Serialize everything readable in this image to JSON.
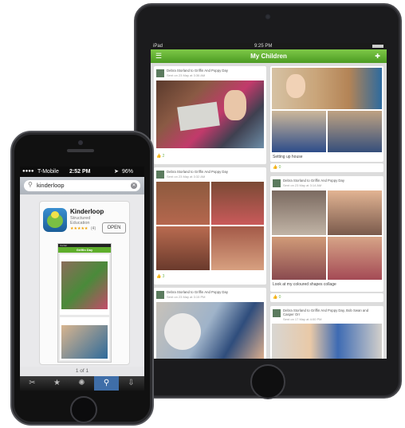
{
  "ipad": {
    "status": {
      "carrier": "iPad",
      "time": "9:25 PM"
    },
    "nav_title": "My Children",
    "cards": [
      {
        "who": "Debra Storland to Griffin And Poppy Day",
        "when": "Sent on 23 May at 3:36 AM",
        "caption": "",
        "likes": "2"
      },
      {
        "who": "",
        "when": "",
        "caption": "Setting up house",
        "likes": "0"
      },
      {
        "who": "Debra Storland to Griffin And Poppy Day",
        "when": "Sent on 23 May at 3:32 AM",
        "caption": "",
        "likes": "3"
      },
      {
        "who": "Debra Storland to Griffin And Poppy Day",
        "when": "Sent on 23 May at 3:14 AM",
        "caption": "Look at my coloured shapes collage",
        "likes": "0"
      },
      {
        "who": "Debra Storland to Griffin And Poppy Day",
        "when": "Sent on 23 May at 3:15 PM",
        "caption": "",
        "likes": ""
      },
      {
        "who": "Debra Storland to Griffin And Poppy Day, Bob Swan and Casper Orr",
        "when": "Sent on 17 May at 4:00 PM",
        "caption": "",
        "likes": ""
      }
    ]
  },
  "iphone": {
    "status": {
      "carrier": "T-Mobile",
      "time": "2:52 PM",
      "battery": "96%"
    },
    "search_query": "kinderloop",
    "app": {
      "name": "Kinderloop",
      "developer": "Structured Education",
      "stars": "★★★★★",
      "rating_count": "(4)",
      "open_label": "OPEN"
    },
    "preview": {
      "nav_title": "Griffin Day",
      "carrier": "Carrier"
    },
    "pager": "1 of 1",
    "tabs": [
      "featured-icon",
      "star-icon",
      "atom-icon",
      "search-icon",
      "download-icon"
    ]
  },
  "colors": {
    "green_nav": "#5fae2c",
    "like_green": "#7ab85a"
  }
}
